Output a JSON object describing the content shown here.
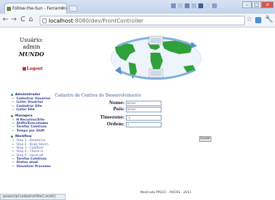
{
  "browser": {
    "tab_title": "Follow-the-Sun - Ferramen",
    "tab_close": "×",
    "nav_back": "←",
    "nav_forward": "→",
    "nav_reload": "C",
    "nav_home": "⌂",
    "url_host": "localhost",
    "url_path": ":8080/dev/FrontController",
    "star": "☆",
    "wrench": "🔧",
    "window_min": "–",
    "window_max": "□",
    "window_close": "×"
  },
  "user": {
    "label": "Usuário:",
    "login": "admin",
    "name": "MUNDO"
  },
  "logout_label": "Logout",
  "menu": {
    "sections": [
      {
        "title": "Administrador",
        "items": [
          "Cadastrar Usuários",
          "Listar Usuários",
          "Cadastrar Site",
          "Listar Site"
        ]
      },
      {
        "title": "Managers",
        "items": [
          "N Recursos/Site",
          "Shifts/Executadas",
          "Tarefas Coletivas",
          "Tempo por Shift"
        ]
      },
      {
        "title": "Workflow",
        "items": [
          "Step 1 - Relatórios",
          "Step 2 - Brain Storm",
          "Step 3 - Codificar",
          "Step 4 - Check-in",
          "Step 5 - Hand-off",
          "Tarefas Coletivas",
          "Status atual",
          "Visualizar Processo"
        ]
      }
    ]
  },
  "form": {
    "title": "Cadastro de Centros de Desenvolvimento",
    "fields": [
      {
        "label": "Nome:",
        "value": "Brasil"
      },
      {
        "label": "País:",
        "value": "Brasil"
      },
      {
        "label": "Timezone:",
        "value": "-3"
      },
      {
        "label": "Ordem:",
        "value": "1"
      }
    ],
    "submit_label": "Enviar"
  },
  "footer": "Mestrado PPGCC - PUCRS - 2011",
  "status_bar": "javascript:cadastrarSite().ecall()"
}
